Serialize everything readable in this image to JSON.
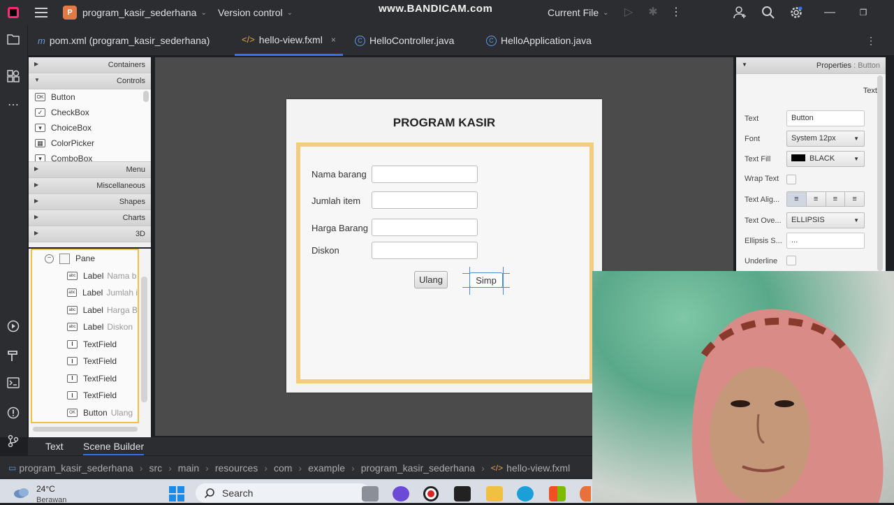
{
  "titlebar": {
    "project_badge": "P",
    "project_name": "program_kasir_sederhana",
    "vcs": "Version control",
    "watermark": "www.BANDICAM.com",
    "run_config": "Current File"
  },
  "editor_tabs": [
    {
      "icon": "m",
      "label": "pom.xml (program_kasir_sederhana)"
    },
    {
      "icon": "</>",
      "label": "hello-view.fxml",
      "close": "×"
    },
    {
      "icon": "C",
      "label": "HelloController.java"
    },
    {
      "icon": "C",
      "label": "HelloApplication.java"
    }
  ],
  "library": {
    "sections": [
      "Containers",
      "Controls",
      "Menu",
      "Miscellaneous",
      "Shapes",
      "Charts",
      "3D"
    ],
    "controls": [
      {
        "icon": "OK",
        "label": "Button"
      },
      {
        "icon": "✓",
        "label": "CheckBox"
      },
      {
        "icon": "▾",
        "label": "ChoiceBox"
      },
      {
        "icon": "▦",
        "label": "ColorPicker"
      },
      {
        "icon": "▾",
        "label": "ComboBox"
      }
    ]
  },
  "hierarchy": {
    "root": "Pane",
    "rows": [
      {
        "icon": "abc",
        "type": "Label",
        "hint": "Nama b"
      },
      {
        "icon": "abc",
        "type": "Label",
        "hint": "Jumlah i"
      },
      {
        "icon": "abc",
        "type": "Label",
        "hint": "Harga B"
      },
      {
        "icon": "abc",
        "type": "Label",
        "hint": "Diskon"
      },
      {
        "icon": "I",
        "type": "TextField",
        "hint": ""
      },
      {
        "icon": "I",
        "type": "TextField",
        "hint": ""
      },
      {
        "icon": "I",
        "type": "TextField",
        "hint": ""
      },
      {
        "icon": "I",
        "type": "TextField",
        "hint": ""
      },
      {
        "icon": "OK",
        "type": "Button",
        "hint": "Ulang"
      }
    ]
  },
  "form": {
    "title": "PROGRAM KASIR",
    "labels": [
      "Nama barang",
      "Jumlah item",
      "Harga Barang",
      "Diskon"
    ],
    "btn_reset": "Ulang",
    "btn_save": "Simp"
  },
  "properties": {
    "header": "Properties",
    "header_suffix": ": Button",
    "section": "Text",
    "text_label": "Text",
    "text_value": "Button",
    "font_label": "Font",
    "font_value": "System 12px",
    "fill_label": "Text Fill",
    "fill_value": "BLACK",
    "wrap_label": "Wrap Text",
    "align_label": "Text Alig...",
    "overrun_label": "Text Ove...",
    "overrun_value": "ELLIPSIS",
    "ellipsis_label": "Ellipsis S...",
    "ellipsis_value": "...",
    "underline_label": "Underline"
  },
  "bottom_tabs": [
    "Text",
    "Scene Builder"
  ],
  "breadcrumbs": [
    "program_kasir_sederhana",
    "src",
    "main",
    "resources",
    "com",
    "example",
    "program_kasir_sederhana",
    "hello-view.fxml"
  ],
  "taskbar": {
    "temp": "24°C",
    "weather": "Berawan",
    "search": "Search"
  },
  "colors": {
    "accent": "#3574f0",
    "form_border": "#f2cc80",
    "selection": "#4a8ad8"
  }
}
